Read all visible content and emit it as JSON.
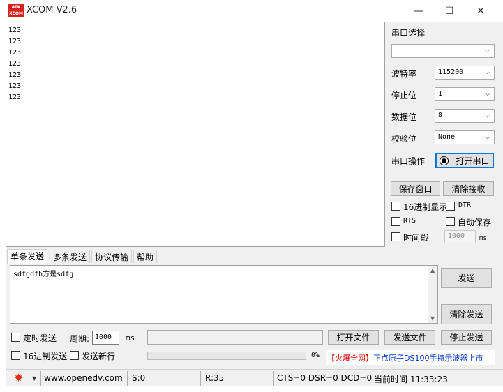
{
  "window": {
    "title": "XCOM V2.6",
    "logo_text": "ATK XCOM",
    "minimize_glyph": "—",
    "maximize_glyph": "☐",
    "close_glyph": "✕"
  },
  "receive": {
    "lines": [
      "123",
      "123",
      "123",
      "123",
      "123",
      "123",
      "123"
    ]
  },
  "settings": {
    "port_select_label": "串口选择",
    "port_value": "",
    "baud_label": "波特率",
    "baud_value": "115200",
    "stop_label": "停止位",
    "stop_value": "1",
    "data_label": "数据位",
    "data_value": "8",
    "parity_label": "校验位",
    "parity_value": "None",
    "port_op_label": "串口操作",
    "open_port_label": "打开串口",
    "save_window_label": "保存窗口",
    "clear_recv_label": "清除接收",
    "hex_display_label": "16进制显示",
    "dtr_label": "DTR",
    "rts_label": "RTS",
    "auto_save_label": "自动保存",
    "timestamp_label": "时间戳",
    "timestamp_value": "1000",
    "ms_label": "ms"
  },
  "tabs": [
    "单条发送",
    "多条发送",
    "协议传输",
    "帮助"
  ],
  "send": {
    "text": "sdfgdfh方是sdfg",
    "send_label": "发送",
    "clear_send_label": "清除发送",
    "timed_send_label": "定时发送",
    "period_label": "周期:",
    "period_value": "1000",
    "period_unit": "ms",
    "file_path": "",
    "open_file_label": "打开文件",
    "send_file_label": "发送文件",
    "stop_send_label": "停止发送",
    "hex_send_label": "16进制发送",
    "newline_label": "发送新行",
    "progress_text": "0%",
    "progress_fraction": 0,
    "ad_prefix": "【火爆全网】",
    "ad_text": "正点原子DS100手持示波器上市"
  },
  "status": {
    "website": "www.openedv.com",
    "sent": "S:0",
    "received": "R:35",
    "signals": "CTS=0 DSR=0 DCD=0",
    "time": "当前时间 11:33:23"
  },
  "colors": {
    "logo": "#d8201c",
    "ad_prefix": "#d40000",
    "ad_text": "#0033cc",
    "gear": "#e03010"
  }
}
